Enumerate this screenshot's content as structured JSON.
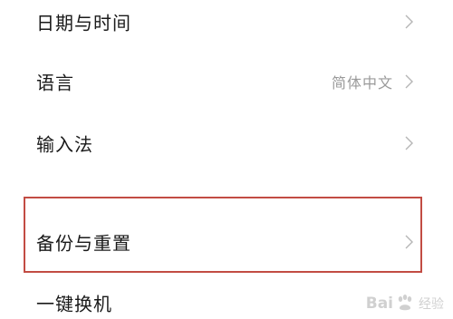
{
  "settings": {
    "items": [
      {
        "label": "日期与时间",
        "value": ""
      },
      {
        "label": "语言",
        "value": "简体中文"
      },
      {
        "label": "输入法",
        "value": ""
      },
      {
        "label": "备份与重置",
        "value": ""
      },
      {
        "label": "一键换机",
        "value": ""
      }
    ]
  },
  "watermark": {
    "brand_prefix": "Bai",
    "brand_suffix": "经验",
    "icon": "paw-icon"
  },
  "colors": {
    "label": "#1a1a1a",
    "value": "#9a9a9a",
    "chevron": "#b5b5b5",
    "highlight_border": "#c24c43"
  }
}
